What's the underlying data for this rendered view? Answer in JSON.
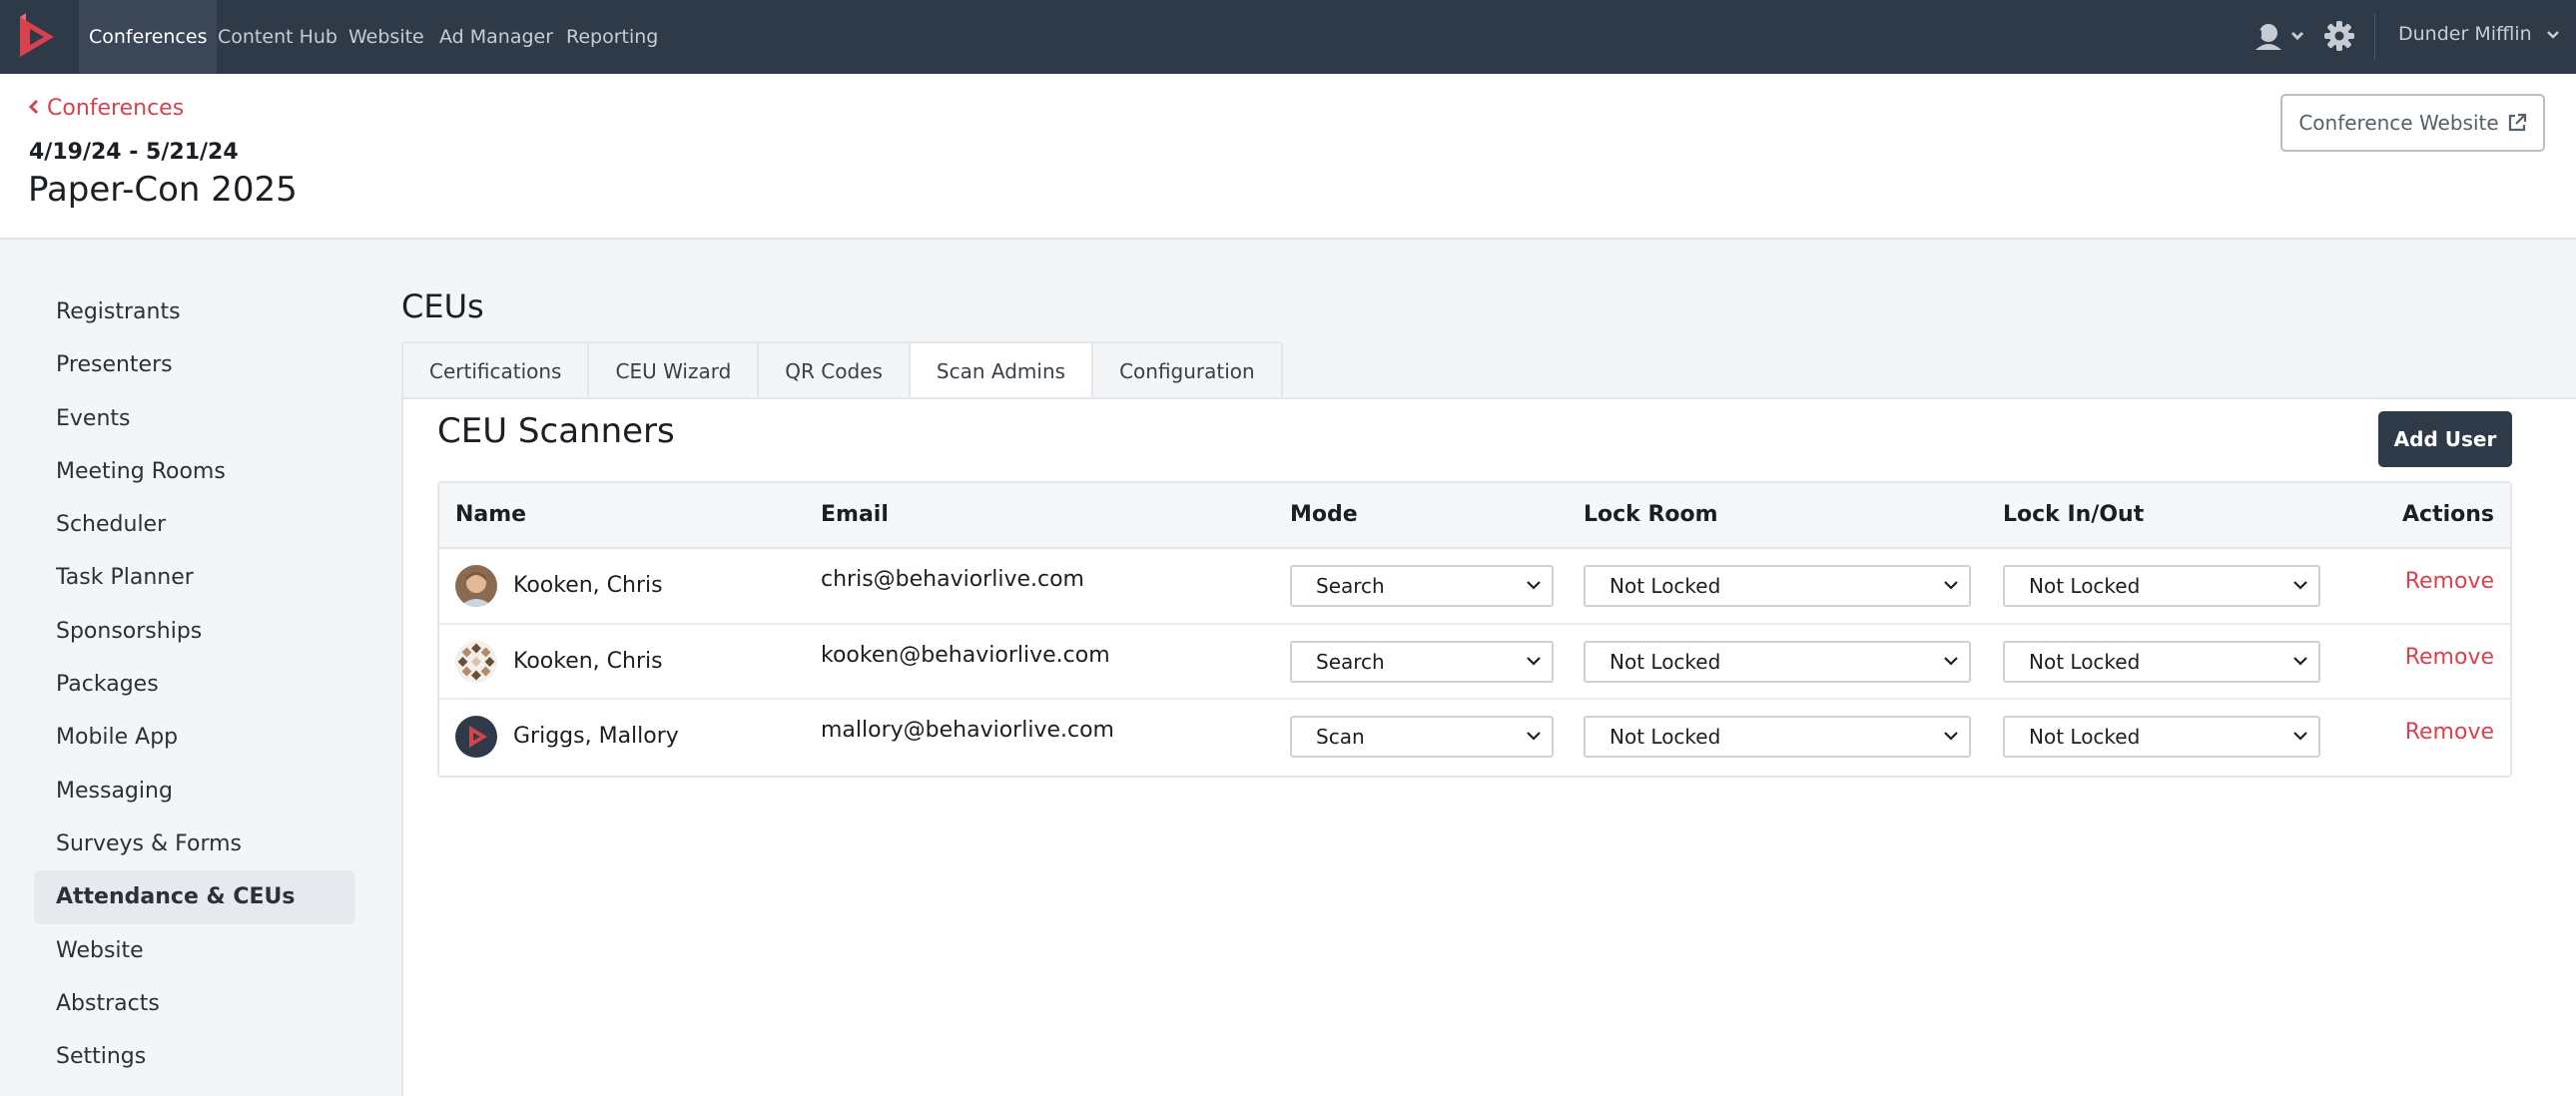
{
  "nav": {
    "items": [
      {
        "label": "Conferences",
        "active": true
      },
      {
        "label": "Content Hub"
      },
      {
        "label": "Website"
      },
      {
        "label": "Ad Manager"
      },
      {
        "label": "Reporting"
      }
    ],
    "user": "Dunder Mifflin",
    "brand_color": "#d8414e"
  },
  "header": {
    "back_label": "Conferences",
    "date_range": "4/19/24 - 5/21/24",
    "title": "Paper-Con 2025",
    "website_button": "Conference Website"
  },
  "sidebar": {
    "items": [
      "Registrants",
      "Presenters",
      "Events",
      "Meeting Rooms",
      "Scheduler",
      "Task Planner",
      "Sponsorships",
      "Packages",
      "Mobile App",
      "Messaging",
      "Surveys & Forms",
      "Attendance & CEUs",
      "Website",
      "Abstracts",
      "Settings"
    ],
    "active": "Attendance & CEUs"
  },
  "main": {
    "title": "CEUs",
    "tabs": [
      "Certifications",
      "CEU Wizard",
      "QR Codes",
      "Scan Admins",
      "Configuration"
    ],
    "active_tab": "Scan Admins",
    "panel_title": "CEU Scanners",
    "add_button": "Add User"
  },
  "table": {
    "headers": {
      "name": "Name",
      "email": "Email",
      "mode": "Mode",
      "lock_room": "Lock Room",
      "lock_inout": "Lock In/Out",
      "actions": "Actions"
    },
    "rows": [
      {
        "name": "Kooken, Chris",
        "email": "chris@behaviorlive.com",
        "mode": "Search",
        "lock_room": "Not Locked",
        "lock_inout": "Not Locked",
        "action": "Remove",
        "avatar": "photo-avatar"
      },
      {
        "name": "Kooken, Chris",
        "email": "kooken@behaviorlive.com",
        "mode": "Search",
        "lock_room": "Not Locked",
        "lock_inout": "Not Locked",
        "action": "Remove",
        "avatar": "pattern-avatar"
      },
      {
        "name": "Griggs, Mallory",
        "email": "mallory@behaviorlive.com",
        "mode": "Scan",
        "lock_room": "Not Locked",
        "lock_inout": "Not Locked",
        "action": "Remove",
        "avatar": "logo-avatar"
      }
    ]
  }
}
